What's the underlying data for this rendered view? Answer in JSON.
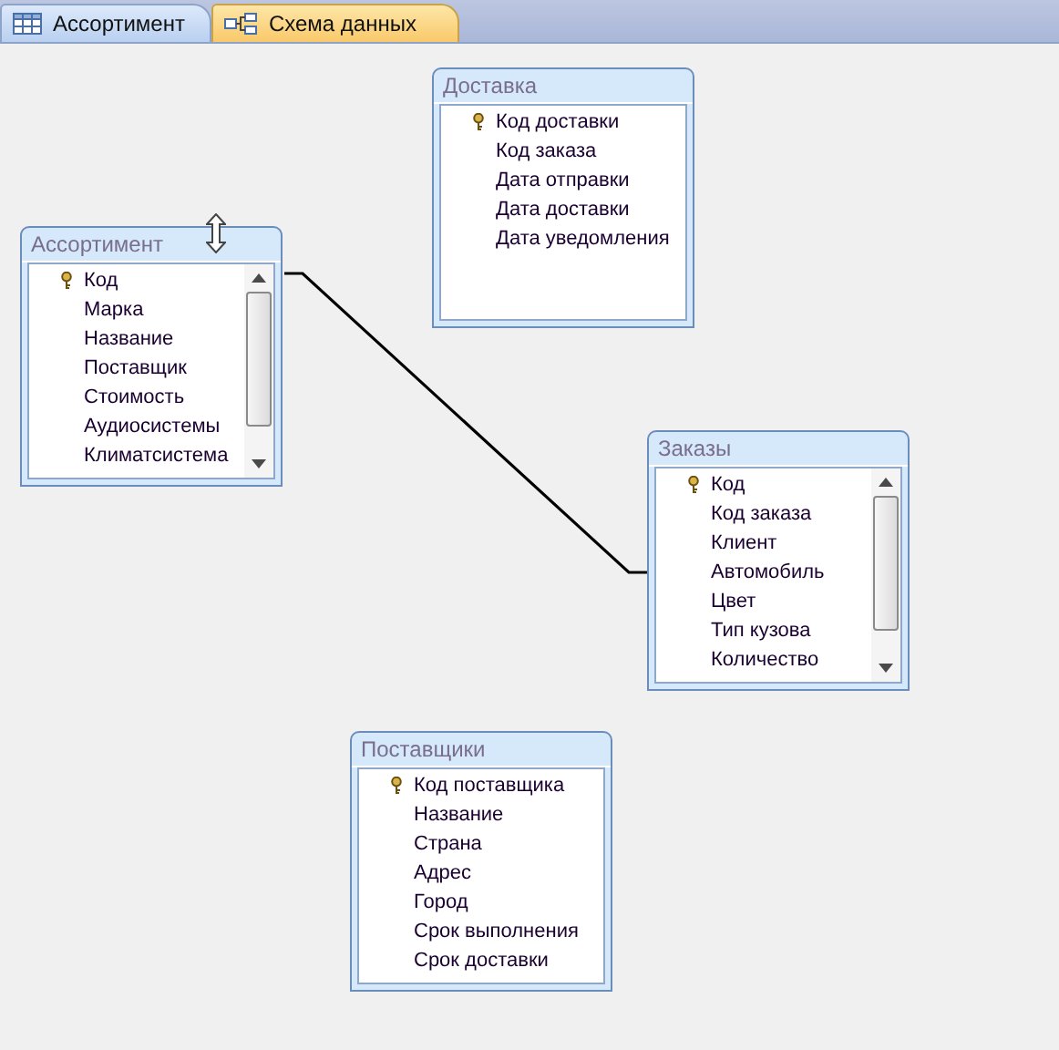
{
  "tabs": [
    {
      "label": "Ассортимент",
      "kind": "table",
      "selected": false
    },
    {
      "label": "Схема данных",
      "kind": "diagram",
      "selected": true
    }
  ],
  "tables": [
    {
      "title": "Доставка",
      "scrollable": false,
      "fields": [
        {
          "name": "Код доставки",
          "primary_key": true
        },
        {
          "name": "Код заказа",
          "primary_key": false
        },
        {
          "name": "Дата отправки",
          "primary_key": false
        },
        {
          "name": "Дата доставки",
          "primary_key": false
        },
        {
          "name": "Дата уведомления",
          "primary_key": false
        }
      ]
    },
    {
      "title": "Ассортимент",
      "scrollable": true,
      "fields": [
        {
          "name": "Код",
          "primary_key": true
        },
        {
          "name": "Марка",
          "primary_key": false
        },
        {
          "name": "Название",
          "primary_key": false
        },
        {
          "name": "Поставщик",
          "primary_key": false
        },
        {
          "name": "Стоимость",
          "primary_key": false
        },
        {
          "name": "Аудиосистемы",
          "primary_key": false
        },
        {
          "name": "Климатсистема",
          "primary_key": false
        }
      ]
    },
    {
      "title": "Заказы",
      "scrollable": true,
      "fields": [
        {
          "name": "Код",
          "primary_key": true
        },
        {
          "name": "Код заказа",
          "primary_key": false
        },
        {
          "name": "Клиент",
          "primary_key": false
        },
        {
          "name": "Автомобиль",
          "primary_key": false
        },
        {
          "name": "Цвет",
          "primary_key": false
        },
        {
          "name": "Тип кузова",
          "primary_key": false
        },
        {
          "name": "Количество",
          "primary_key": false
        }
      ]
    },
    {
      "title": "Поставщики",
      "scrollable": false,
      "fields": [
        {
          "name": "Код поставщика",
          "primary_key": true
        },
        {
          "name": "Название",
          "primary_key": false
        },
        {
          "name": "Страна",
          "primary_key": false
        },
        {
          "name": "Адрес",
          "primary_key": false
        },
        {
          "name": "Город",
          "primary_key": false
        },
        {
          "name": "Срок выполнения",
          "primary_key": false
        },
        {
          "name": "Срок доставки",
          "primary_key": false
        }
      ]
    }
  ]
}
